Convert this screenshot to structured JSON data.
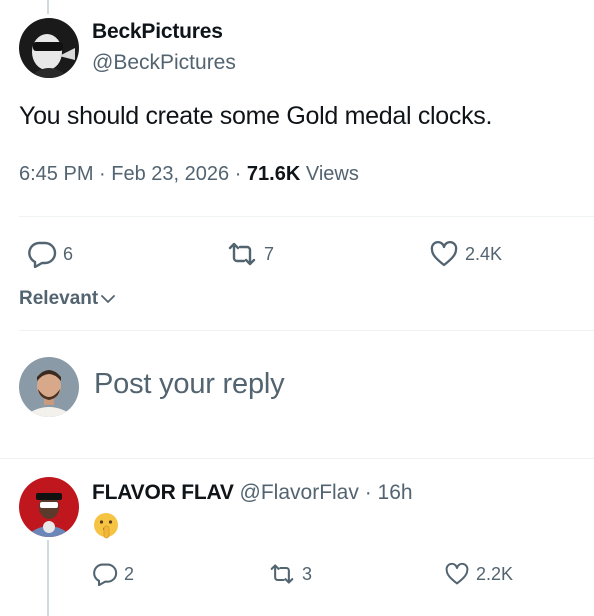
{
  "tweet": {
    "author_name": "BeckPictures",
    "author_handle": "@BeckPictures",
    "text": "You should create some Gold medal clocks.",
    "time": "6:45 PM",
    "date": "Feb 23, 2026",
    "views_count": "71.6K",
    "views_label": "Views",
    "replies": "6",
    "reposts": "7",
    "likes": "2.4K"
  },
  "sort": {
    "label": "Relevant"
  },
  "composer": {
    "placeholder": "Post your reply"
  },
  "reply": {
    "author_name": "FLAVOR FLAV",
    "author_handle": "@FlavorFlav",
    "time": "16h",
    "emoji": "shushing-face",
    "replies": "2",
    "reposts": "3",
    "likes": "2.2K"
  },
  "colors": {
    "text": "#0f1419",
    "muted": "#536471",
    "divider": "#eff3f4",
    "thread_line": "#cfd9de"
  }
}
